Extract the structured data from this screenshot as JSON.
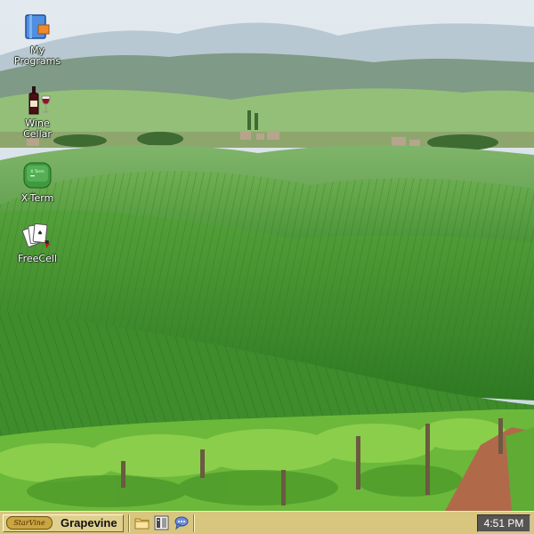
{
  "desktop": {
    "wallpaper": {
      "subject": "rolling-green-vineyard-hills",
      "colors": {
        "sky": "#dde6ec",
        "hill": "#5fa046",
        "vines": "#7cc443"
      }
    },
    "icons": [
      {
        "label": "My\nPrograms",
        "icon": "programs-icon"
      },
      {
        "label": "Wine\nCellar",
        "icon": "wine-bottle-glass-icon"
      },
      {
        "label": "X-Term",
        "icon": "xterm-icon"
      },
      {
        "label": "FreeCell",
        "icon": "playing-cards-icon"
      }
    ]
  },
  "taskbar": {
    "start_logo_text": "StarVine",
    "start_label": "Grapevine",
    "quick_launch": [
      {
        "icon": "folder-icon"
      },
      {
        "icon": "terminal-icon"
      },
      {
        "icon": "chat-icon"
      }
    ],
    "clock": "4:51 PM",
    "colors": {
      "bar": "#d8c67f",
      "clock_bg": "#565553"
    }
  }
}
